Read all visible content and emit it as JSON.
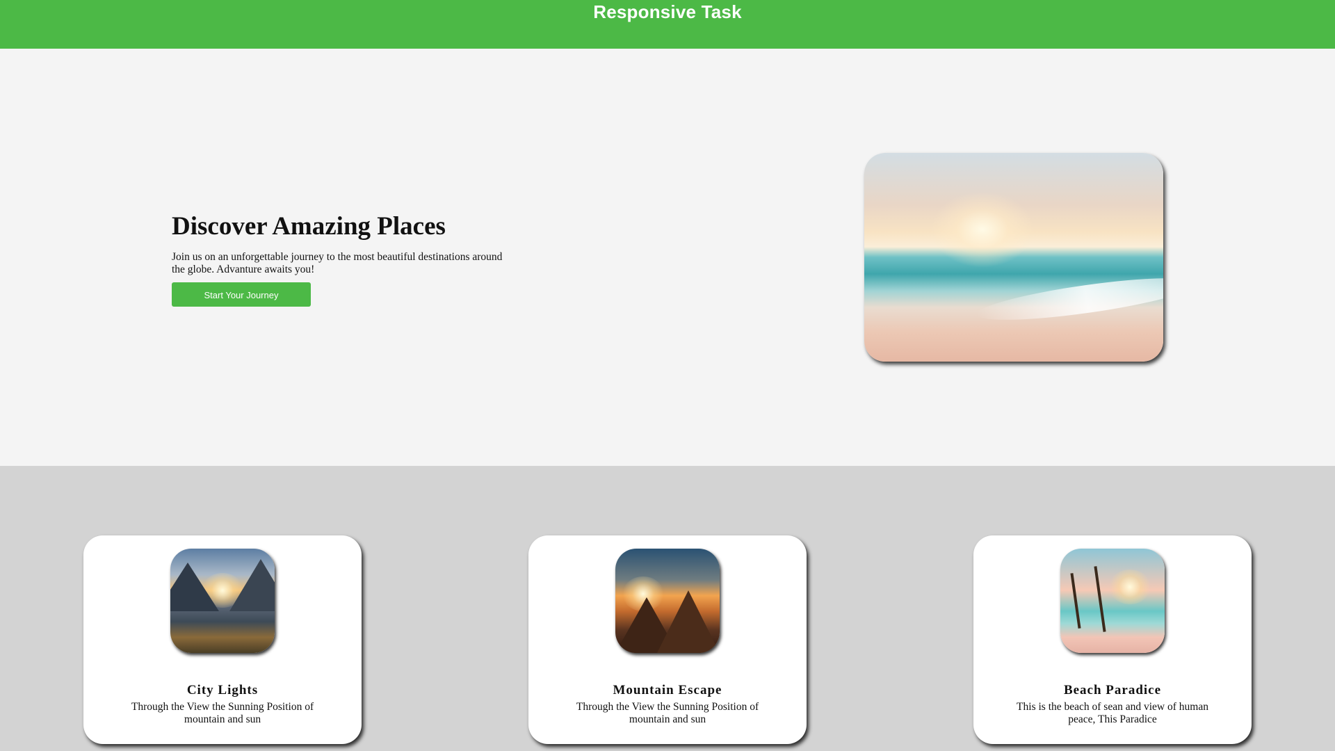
{
  "header": {
    "title": "Responsive Task"
  },
  "hero": {
    "heading": "Discover Amazing Places",
    "text": "Join us on an unforgettable journey to the most beautiful destinations around the globe. Advanture awaits you!",
    "button_label": "Start Your Journey",
    "image": "beach-sunset-image"
  },
  "cards": [
    {
      "title": "City Lights",
      "text": "Through the View the Sunning Position of mountain and sun",
      "image": "mountain-valley-sunset-image"
    },
    {
      "title": "Mountain Escape",
      "text": "Through the View the Sunning Position of mountain and sun",
      "image": "mountain-sunrise-image"
    },
    {
      "title": "Beach Paradice",
      "text": "This is the beach of sean and view of human peace, This Paradice",
      "image": "tropical-beach-palm-image"
    }
  ],
  "colors": {
    "accent": "#4cb946",
    "hero_bg": "#f4f4f4",
    "section_bg": "#d3d3d3",
    "card_bg": "#ffffff"
  }
}
